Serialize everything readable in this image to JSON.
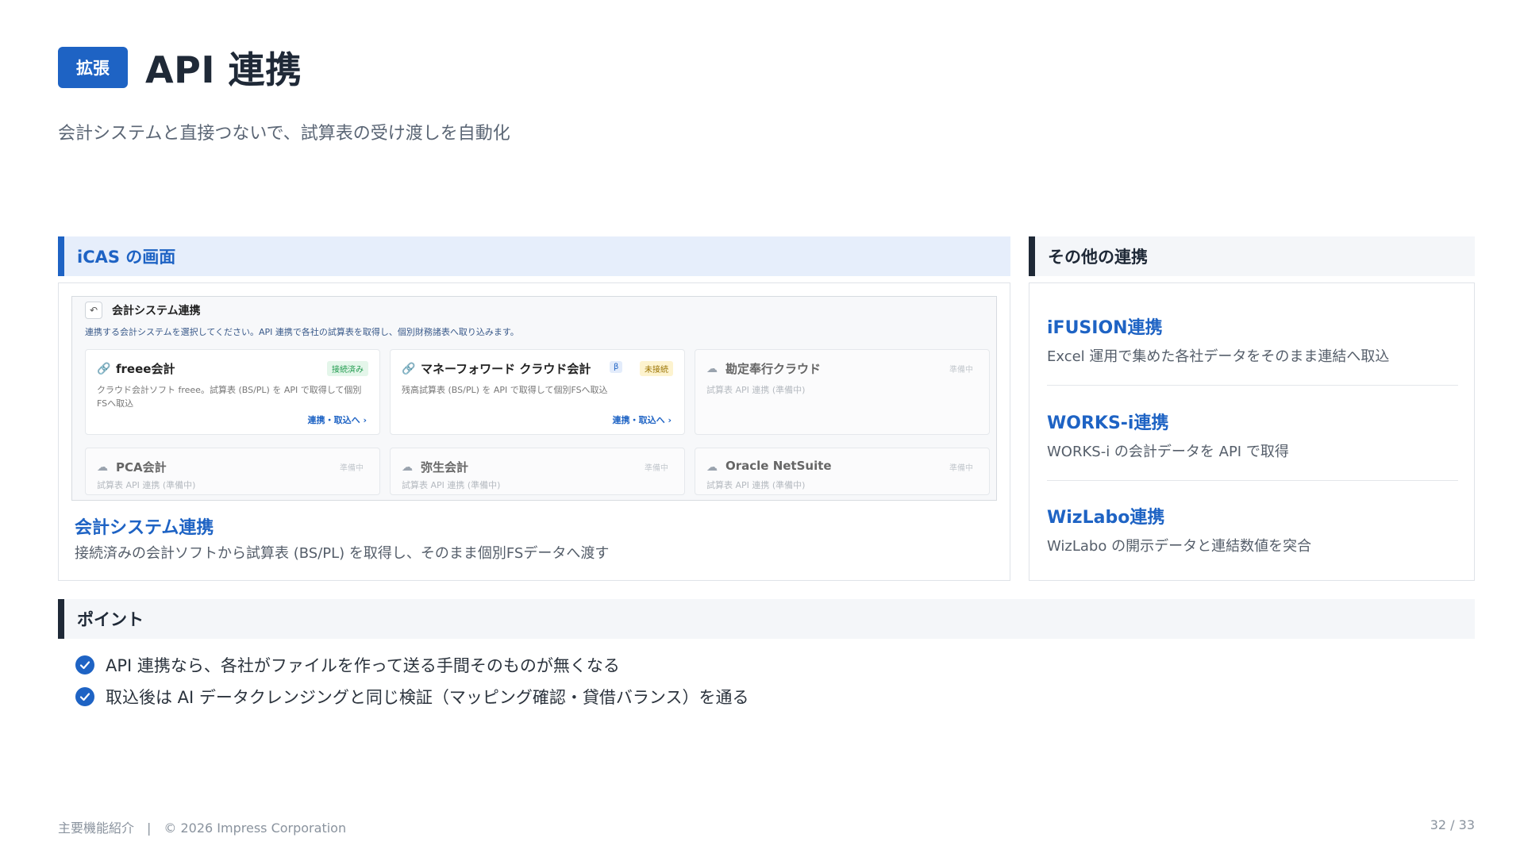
{
  "header": {
    "badge": "拡張",
    "title": "API 連携",
    "subtitle": "会計システムと直接つないで、試算表の受け渡しを自動化"
  },
  "left_section": {
    "heading": "iCAS の画面",
    "screenshot": {
      "title": "会計システム連携",
      "description": "連携する会計システムを選択してください。API 連携で各社の試算表を取得し、個別財務諸表へ取り込みます。",
      "cards": [
        {
          "name": "freee会計",
          "status": "接続済み",
          "text": "クラウド会計ソフト freee。試算表 (BS/PL) を API で取得して個別FSへ取込",
          "link": "連携・取込へ ›"
        },
        {
          "name": "マネーフォワード クラウド会計",
          "beta": "β",
          "status": "未接続",
          "text": "残高試算表 (BS/PL) を API で取得して個別FSへ取込",
          "link": "連携・取込へ ›"
        },
        {
          "name": "勘定奉行クラウド",
          "status": "準備中",
          "text": "試算表 API 連携 (準備中)"
        },
        {
          "name": "PCA会計",
          "status": "準備中",
          "text": "試算表 API 連携 (準備中)"
        },
        {
          "name": "弥生会計",
          "status": "準備中",
          "text": "試算表 API 連携 (準備中)"
        },
        {
          "name": "Oracle NetSuite",
          "status": "準備中",
          "text": "試算表 API 連携 (準備中)"
        }
      ]
    },
    "caption_title": "会計システム連携",
    "caption_text": "接続済みの会計ソフトから試算表 (BS/PL) を取得し、そのまま個別FSデータへ渡す"
  },
  "right_section": {
    "heading": "その他の連携",
    "items": [
      {
        "title": "iFUSION連携",
        "text": "Excel 運用で集めた各社データをそのまま連結へ取込"
      },
      {
        "title": "WORKS-i連携",
        "text": "WORKS-i の会計データを API で取得"
      },
      {
        "title": "WizLabo連携",
        "text": "WizLabo の開示データと連結数値を突合"
      }
    ]
  },
  "points": {
    "heading": "ポイント",
    "items": [
      "API 連携なら、各社がファイルを作って送る手間そのものが無くなる",
      "取込後は AI データクレンジングと同じ検証（マッピング確認・貸借バランス）を通る"
    ]
  },
  "footer": {
    "left": "主要機能紹介　|　© 2026 Impress Corporation",
    "page": "32 / 33"
  },
  "colors": {
    "accent": "#1e63c4",
    "text": "#1f2937"
  }
}
